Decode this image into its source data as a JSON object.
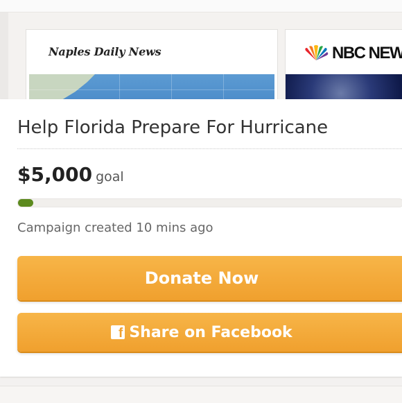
{
  "media": {
    "card1": {
      "logo_text": "Naples Daily News",
      "image_icon": "hurricane-map-thumbnail"
    },
    "card2": {
      "logo_text": "NBC NEWS",
      "logo_icon": "nbc-peacock-icon",
      "image_icon": "satellite-storm-thumbnail"
    }
  },
  "campaign": {
    "title": "Help Florida Prepare For Hurricane",
    "goal_amount": "$5,000",
    "goal_label": "goal",
    "progress_fraction": 0.04,
    "created_text": "Campaign created 10 mins ago"
  },
  "actions": {
    "donate_label": "Donate Now",
    "share_label": "Share on Facebook",
    "share_icon": "facebook-icon"
  },
  "colors": {
    "button_accent": "#f0a02e",
    "progress_fill": "#5c8a1e"
  }
}
